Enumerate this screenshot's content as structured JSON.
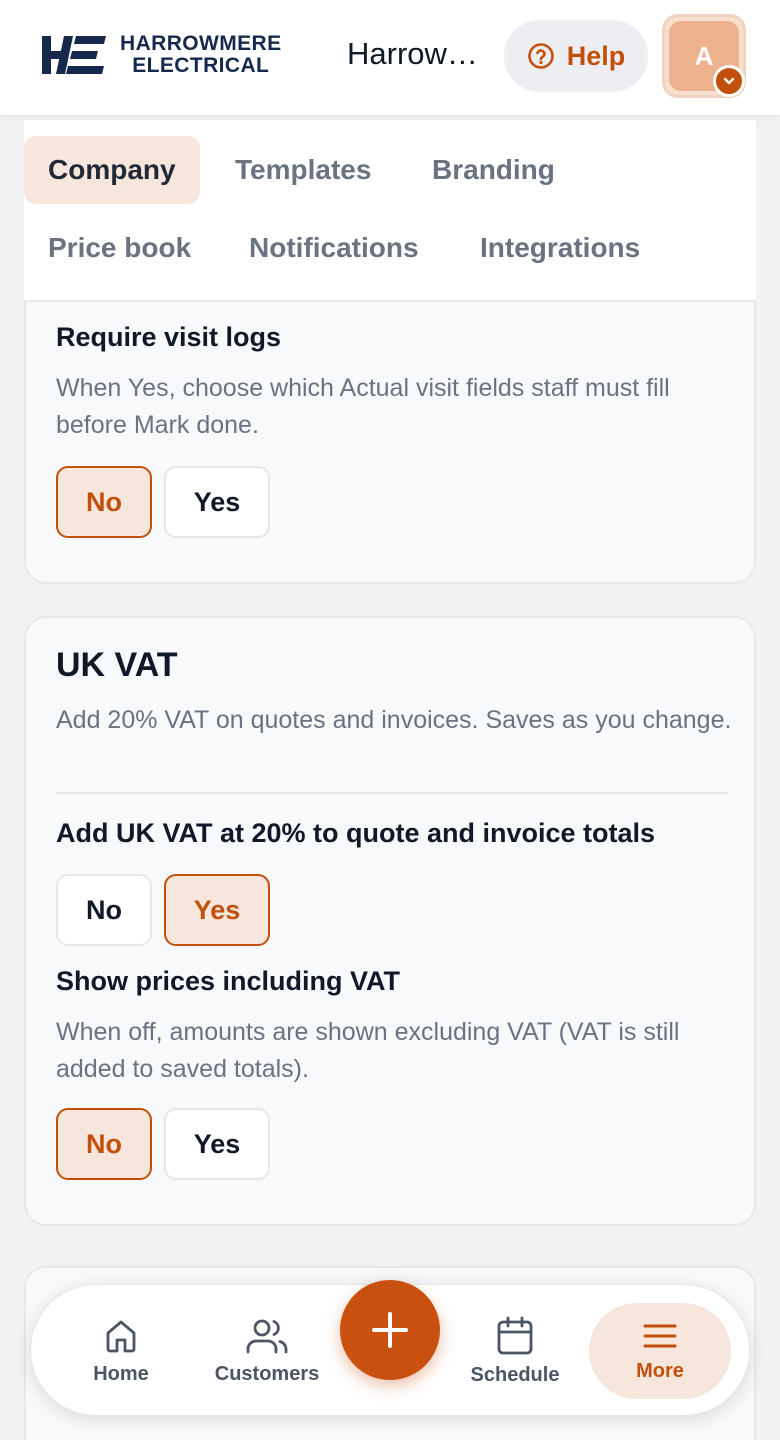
{
  "header": {
    "logo_line1": "HARROWMERE",
    "logo_line2": "ELECTRICAL",
    "company_name": "Harrowmere Electrical",
    "help_label": "Help",
    "avatar_initial": "A"
  },
  "tabs": [
    {
      "label": "Company",
      "active": true
    },
    {
      "label": "Templates"
    },
    {
      "label": "Branding"
    },
    {
      "label": "Price book"
    },
    {
      "label": "Notifications"
    },
    {
      "label": "Integrations"
    }
  ],
  "visit_logs": {
    "label": "Require visit logs",
    "description": "When Yes, choose which Actual visit fields staff must fill before Mark done.",
    "no_label": "No",
    "yes_label": "Yes",
    "selected": "No"
  },
  "uk_vat": {
    "title": "UK VAT",
    "description": "Add 20% VAT on quotes and invoices. Saves as you change.",
    "add_vat": {
      "label": "Add UK VAT at 20% to quote and invoice totals",
      "no_label": "No",
      "yes_label": "Yes",
      "selected": "Yes"
    },
    "show_inc": {
      "label": "Show prices including VAT",
      "description": "When off, amounts are shown excluding VAT (VAT is still added to saved totals).",
      "no_label": "No",
      "yes_label": "Yes",
      "selected": "No"
    }
  },
  "bottom_nav": {
    "home": "Home",
    "customers": "Customers",
    "schedule": "Schedule",
    "more": "More"
  },
  "colors": {
    "accent": "#c2500b",
    "accent_soft": "#f7e6dc",
    "brand_navy": "#16294d"
  }
}
